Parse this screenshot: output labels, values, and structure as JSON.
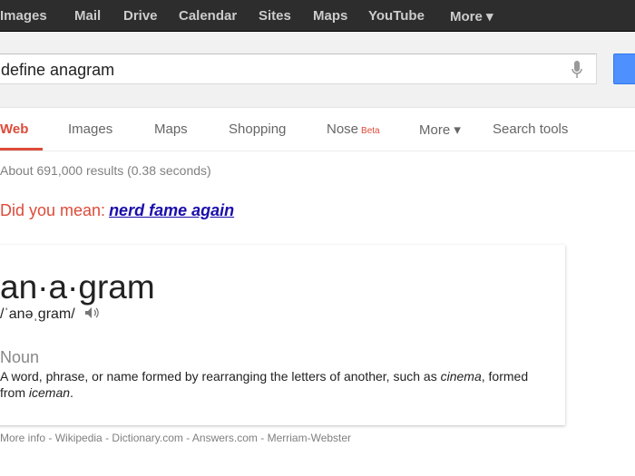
{
  "topbar": {
    "items": [
      "Images",
      "Mail",
      "Drive",
      "Calendar",
      "Sites",
      "Maps",
      "YouTube",
      "More ▾"
    ]
  },
  "search": {
    "query": "define anagram",
    "mic_icon": "microphone-icon",
    "button_icon": "search-icon",
    "button_color": "#4d90fe"
  },
  "tabs": {
    "items": [
      "Web",
      "Images",
      "Maps",
      "Shopping",
      "Nose",
      "More ▾",
      "Search tools"
    ],
    "beta": "Beta",
    "active": "Web",
    "accent": "#dd4b39"
  },
  "results": {
    "count": "About 691,000 results (0.38 seconds)",
    "did_you_mean": "Did you mean:",
    "suggestion": "nerd fame again"
  },
  "definition": {
    "word": "an·a·gram",
    "pronunciation": "/ˈanəˌgram/",
    "speaker_icon": "speaker-icon",
    "pos": "Noun",
    "def_a": "A word, phrase, or name formed by rearranging the letters of another, such as ",
    "ex1": "cinema",
    "def_b": ", formed from ",
    "ex2": "iceman",
    "def_c": "."
  },
  "links": [
    "More info",
    "Wikipedia",
    "Dictionary.com",
    "Answers.com",
    "Merriam-Webster"
  ],
  "sep": " - "
}
